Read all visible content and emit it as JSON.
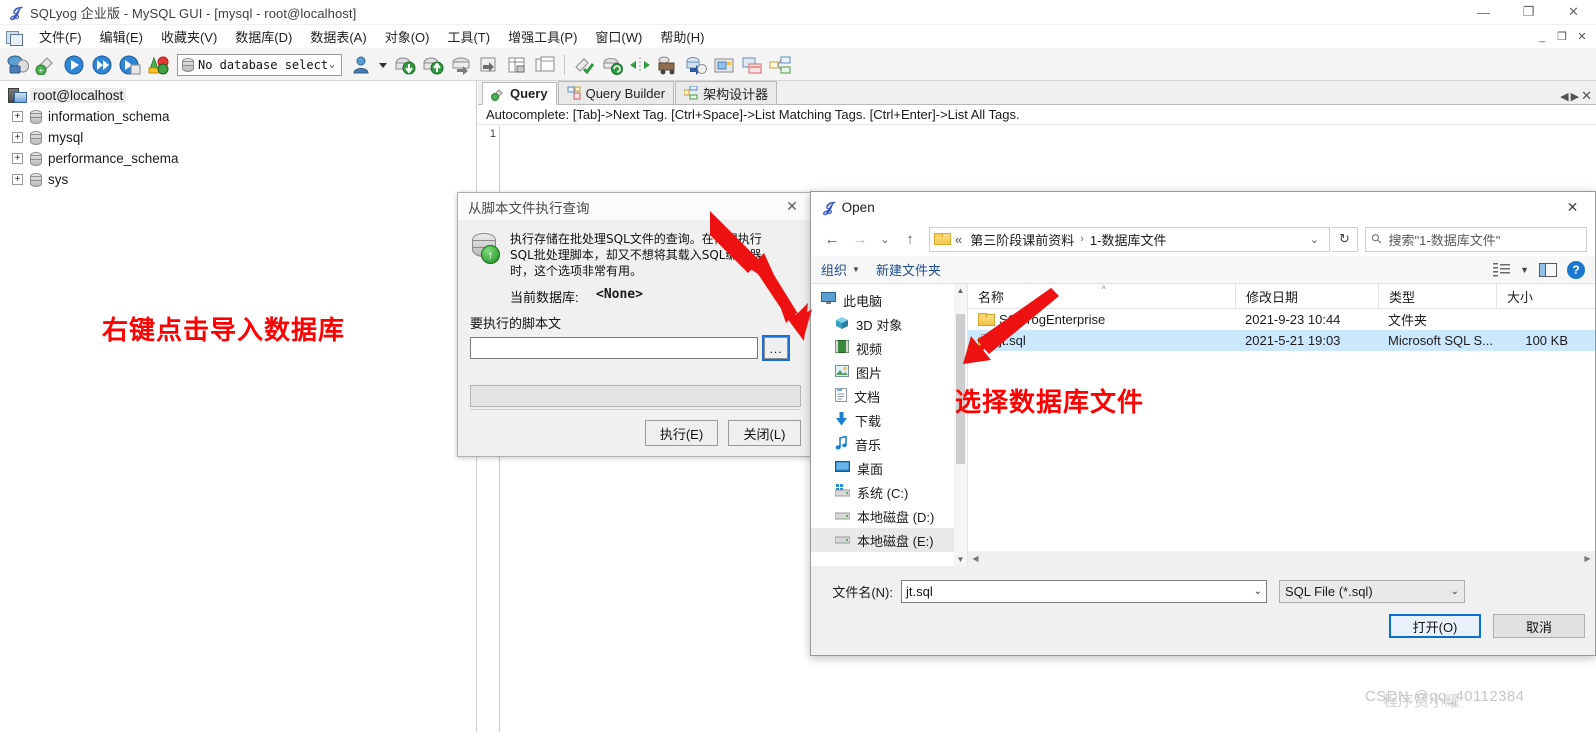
{
  "app": {
    "title": "SQLyog 企业版 - MySQL GUI - [mysql - root@localhost]",
    "window_buttons": {
      "minimize": "—",
      "maximize": "❐",
      "close": "✕"
    },
    "mdi_buttons": {
      "minimize": "_",
      "restore": "❐",
      "close": "✕"
    }
  },
  "menubar": [
    {
      "label": "文件(F)"
    },
    {
      "label": "编辑(E)"
    },
    {
      "label": "收藏夹(V)"
    },
    {
      "label": "数据库(D)"
    },
    {
      "label": "数据表(A)"
    },
    {
      "label": "对象(O)"
    },
    {
      "label": "工具(T)"
    },
    {
      "label": "增强工具(P)"
    },
    {
      "label": "窗口(W)"
    },
    {
      "label": "帮助(H)"
    }
  ],
  "toolbar": {
    "db_combo_value": "No database select",
    "db_combo_caret": "⌄"
  },
  "tree": {
    "root": "root@localhost",
    "nodes": [
      {
        "label": "information_schema",
        "expander": "+"
      },
      {
        "label": "mysql",
        "expander": "+"
      },
      {
        "label": "performance_schema",
        "expander": "+"
      },
      {
        "label": "sys",
        "expander": "+"
      }
    ]
  },
  "editor": {
    "tabs": [
      {
        "label": "Query",
        "active": true
      },
      {
        "label": "Query Builder",
        "active": false
      },
      {
        "label": "架构设计器",
        "active": false
      }
    ],
    "autocomplete_hint": "Autocomplete: [Tab]->Next Tag. [Ctrl+Space]->List Matching Tags. [Ctrl+Enter]->List All Tags.",
    "line_number": "1"
  },
  "annotations": [
    {
      "text": "右键点击导入数据库"
    },
    {
      "text": "选择数据库文件"
    }
  ],
  "script_dialog": {
    "title": "从脚本文件执行查询",
    "close": "✕",
    "description": "执行存储在批处理SQL文件的查询。在你想执行SQL批处理脚本，却又不想将其载入SQL编辑器时，这个选项非常有用。",
    "current_db_label": "当前数据库:",
    "current_db_value": "<None>",
    "file_label": "要执行的脚本文",
    "file_value": "",
    "browse_button": "...",
    "execute_button": "执行(E)",
    "close_button": "关闭(L)"
  },
  "open_dialog": {
    "title": "Open",
    "close": "✕",
    "nav": {
      "back": "←",
      "forward": "→",
      "recent": "⌄",
      "up": "↑",
      "breadcrumb_prefix": "«",
      "breadcrumb": [
        "第三阶段课前资料",
        "1-数据库文件"
      ],
      "breadcrumb_sep": "›",
      "dropdown": "⌄",
      "refresh": "↻"
    },
    "search_placeholder": "搜索\"1-数据库文件\"",
    "commandbar": {
      "organize": "组织",
      "organize_caret": "▼",
      "new_folder": "新建文件夹",
      "help": "?"
    },
    "sidebar": [
      {
        "label": "此电脑",
        "icon": "monitor-icon",
        "root": true
      },
      {
        "label": "3D 对象",
        "icon": "cube-icon"
      },
      {
        "label": "视频",
        "icon": "video-icon"
      },
      {
        "label": "图片",
        "icon": "picture-icon"
      },
      {
        "label": "文档",
        "icon": "document-icon"
      },
      {
        "label": "下载",
        "icon": "download-icon"
      },
      {
        "label": "音乐",
        "icon": "music-icon"
      },
      {
        "label": "桌面",
        "icon": "desktop-icon"
      },
      {
        "label": "系统 (C:)",
        "icon": "windows-drive-icon"
      },
      {
        "label": "本地磁盘 (D:)",
        "icon": "drive-icon"
      },
      {
        "label": "本地磁盘 (E:)",
        "icon": "drive-icon",
        "selected": true
      }
    ],
    "columns": [
      "名称",
      "修改日期",
      "类型",
      "大小"
    ],
    "files": [
      {
        "name": "SQLYogEnterprise",
        "date": "2021-9-23 10:44",
        "type": "文件夹",
        "size": "",
        "icon": "folder-icon",
        "selected": false
      },
      {
        "name": "jt.sql",
        "date": "2021-5-21 19:03",
        "type": "Microsoft SQL S...",
        "size": "100 KB",
        "icon": "sql-file-icon",
        "selected": true
      }
    ],
    "filename_label": "文件名(N):",
    "filename_value": "jt.sql",
    "filetype_value": "SQL File (*.sql)",
    "open_button": "打开(O)",
    "cancel_button": "取消"
  },
  "watermark": {
    "text1": "CSDN @qq_40112384",
    "text2": "程序员小耀"
  }
}
